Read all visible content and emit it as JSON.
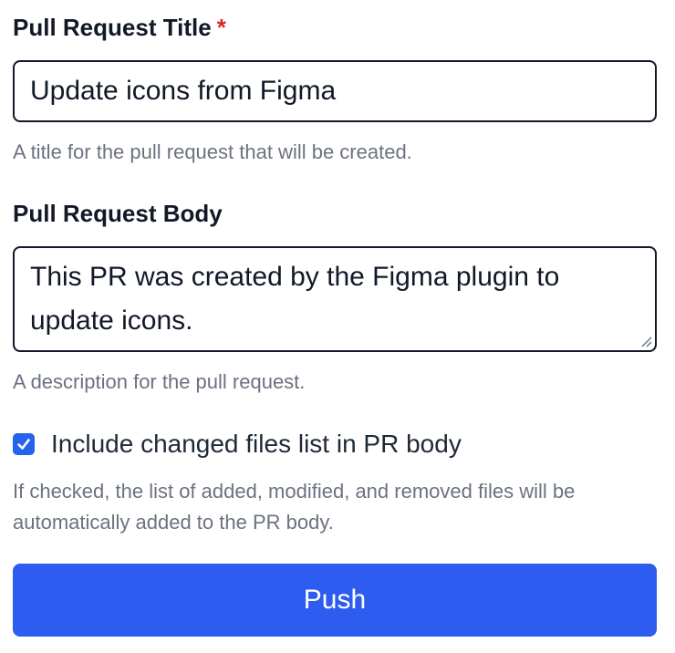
{
  "title_field": {
    "label": "Pull Request Title",
    "required_marker": "*",
    "value": "Update icons from Figma",
    "help": "A title for the pull request that will be created."
  },
  "body_field": {
    "label": "Pull Request Body",
    "value": "This PR was created by the Figma plugin to update icons.",
    "help": "A description for the pull request."
  },
  "changed_files_option": {
    "checked": true,
    "label": "Include changed files list in PR body",
    "help": "If checked, the list of added, modified, and removed files will be automatically added to the PR body."
  },
  "submit": {
    "label": "Push"
  },
  "colors": {
    "accent": "#2e5cf0",
    "checkbox": "#2563eb",
    "required": "#dc2626",
    "help_text": "#6b7280",
    "border": "#111827"
  },
  "icons": {
    "checkbox_mark": "check-icon",
    "textarea_resize": "resize-handle-icon"
  }
}
